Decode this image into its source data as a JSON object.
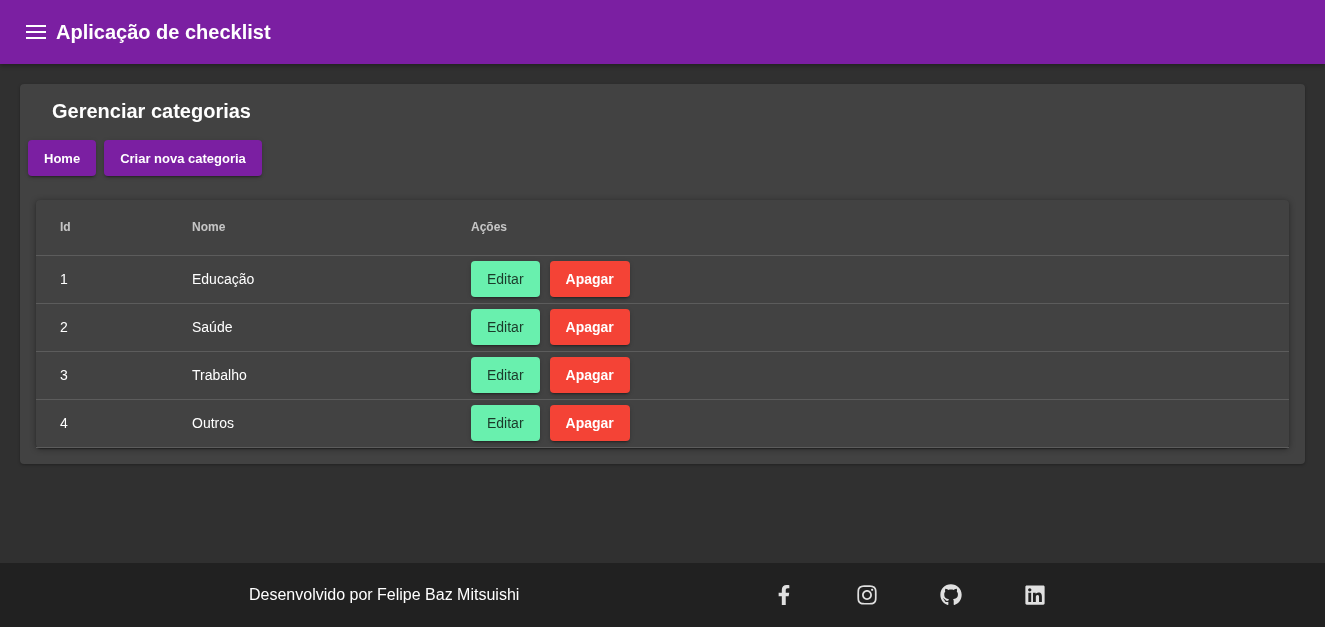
{
  "app_bar": {
    "title": "Aplicação de checklist"
  },
  "page": {
    "title": "Gerenciar categorias",
    "buttons": [
      "Home",
      "Criar nova categoria"
    ]
  },
  "table": {
    "columns": [
      "Id",
      "Nome",
      "Ações"
    ],
    "rows": [
      {
        "id": "1",
        "name": "Educação",
        "actions": [
          {
            "label": "Editar",
            "kind": "edit"
          },
          {
            "label": "Apagar",
            "kind": "delete"
          }
        ]
      },
      {
        "id": "2",
        "name": "Saúde",
        "actions": [
          {
            "label": "Editar",
            "kind": "edit"
          },
          {
            "label": "Apagar",
            "kind": "delete"
          }
        ]
      },
      {
        "id": "3",
        "name": "Trabalho",
        "actions": [
          {
            "label": "Editar",
            "kind": "edit"
          },
          {
            "label": "Apagar",
            "kind": "delete"
          }
        ]
      },
      {
        "id": "4",
        "name": "Outros",
        "actions": [
          {
            "label": "Editar",
            "kind": "edit"
          },
          {
            "label": "Apagar",
            "kind": "delete"
          }
        ]
      }
    ]
  },
  "footer": {
    "credit": "Desenvolvido por Felipe Baz Mitsuishi",
    "social_links": [
      {
        "kind": "facebook"
      },
      {
        "kind": "instagram"
      },
      {
        "kind": "github"
      },
      {
        "kind": "linkedin"
      }
    ]
  }
}
